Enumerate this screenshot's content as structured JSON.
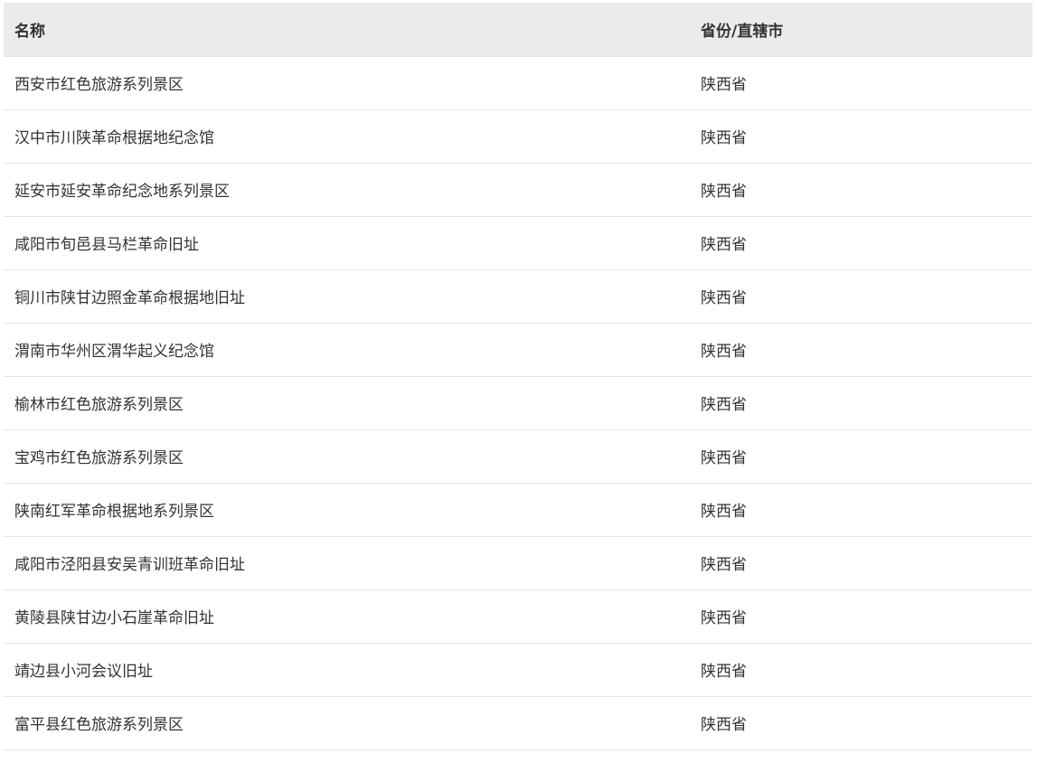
{
  "table": {
    "headers": {
      "name": "名称",
      "province": "省份/直辖市"
    },
    "rows": [
      {
        "name": "西安市红色旅游系列景区",
        "province": "陕西省"
      },
      {
        "name": "汉中市川陕革命根据地纪念馆",
        "province": "陕西省"
      },
      {
        "name": "延安市延安革命纪念地系列景区",
        "province": "陕西省"
      },
      {
        "name": "咸阳市旬邑县马栏革命旧址",
        "province": "陕西省"
      },
      {
        "name": "铜川市陕甘边照金革命根据地旧址",
        "province": "陕西省"
      },
      {
        "name": "渭南市华州区渭华起义纪念馆",
        "province": "陕西省"
      },
      {
        "name": "榆林市红色旅游系列景区",
        "province": "陕西省"
      },
      {
        "name": "宝鸡市红色旅游系列景区",
        "province": "陕西省"
      },
      {
        "name": "陕南红军革命根据地系列景区",
        "province": "陕西省"
      },
      {
        "name": "咸阳市泾阳县安吴青训班革命旧址",
        "province": "陕西省"
      },
      {
        "name": "黄陵县陕甘边小石崖革命旧址",
        "province": "陕西省"
      },
      {
        "name": "靖边县小河会议旧址",
        "province": "陕西省"
      },
      {
        "name": "富平县红色旅游系列景区",
        "province": "陕西省"
      }
    ]
  }
}
